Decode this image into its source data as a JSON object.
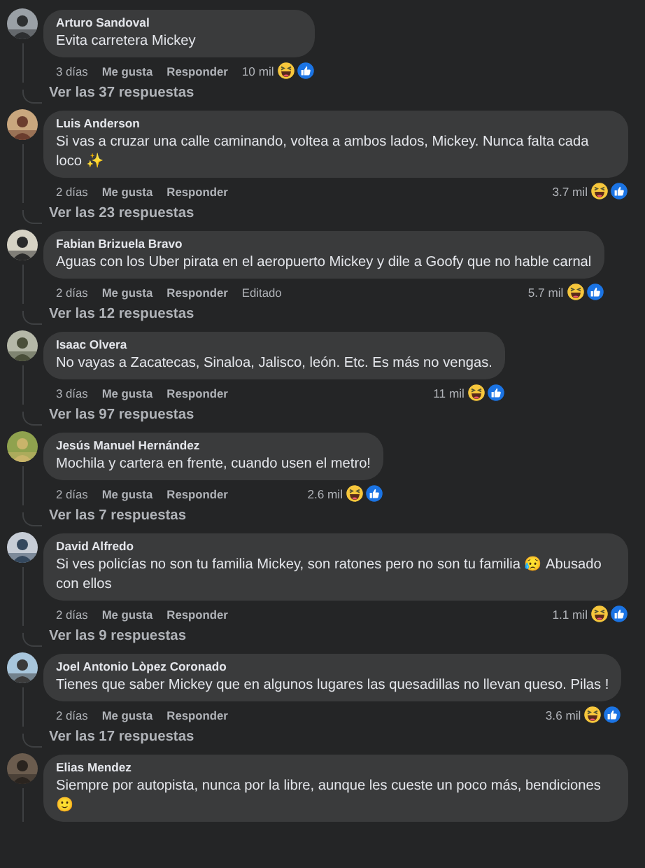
{
  "comments": [
    {
      "name": "Arturo Sandoval",
      "text": "Evita carretera Mickey",
      "time": "3 días",
      "like": "Me gusta",
      "reply": "Responder",
      "reactions": "10 mil",
      "replies": "Ver las 37 respuestas"
    },
    {
      "name": "Luis Anderson",
      "text": "Si vas a cruzar una calle caminando, voltea a ambos lados, Mickey. Nunca falta cada loco ✨",
      "time": "2 días",
      "like": "Me gusta",
      "reply": "Responder",
      "reactions": "3.7 mil",
      "replies": "Ver las 23 respuestas"
    },
    {
      "name": "Fabian Brizuela Bravo",
      "text": "Aguas con los Uber pirata en el aeropuerto Mickey y dile a Goofy que no hable carnal",
      "time": "2 días",
      "like": "Me gusta",
      "reply": "Responder",
      "edited": "Editado",
      "reactions": "5.7 mil",
      "replies": "Ver las 12 respuestas"
    },
    {
      "name": "Isaac Olvera",
      "text": "No vayas a Zacatecas, Sinaloa, Jalisco, león. Etc. Es más no vengas.",
      "time": "3 días",
      "like": "Me gusta",
      "reply": "Responder",
      "reactions": "11 mil",
      "replies": "Ver las 97 respuestas"
    },
    {
      "name": "Jesús Manuel Hernández",
      "text": "Mochila y cartera en frente, cuando usen el metro!",
      "time": "2 días",
      "like": "Me gusta",
      "reply": "Responder",
      "reactions": "2.6 mil",
      "replies": "Ver las 7 respuestas"
    },
    {
      "name": "David Alfredo",
      "text": "Si ves policías no son tu familia Mickey, son ratones pero no son tu familia 😥 Abusado con ellos",
      "time": "2 días",
      "like": "Me gusta",
      "reply": "Responder",
      "reactions": "1.1 mil",
      "replies": "Ver las 9 respuestas"
    },
    {
      "name": "Joel Antonio Lòpez Coronado",
      "text": "Tienes que saber Mickey que en algunos lugares las quesadillas no llevan queso. Pilas !",
      "time": "2 días",
      "like": "Me gusta",
      "reply": "Responder",
      "reactions": "3.6 mil",
      "replies": "Ver las 17 respuestas"
    },
    {
      "name": "Elias Mendez",
      "text": "Siempre por autopista, nunca por la libre, aunque les cueste un poco más, bendiciones 🙂"
    }
  ]
}
